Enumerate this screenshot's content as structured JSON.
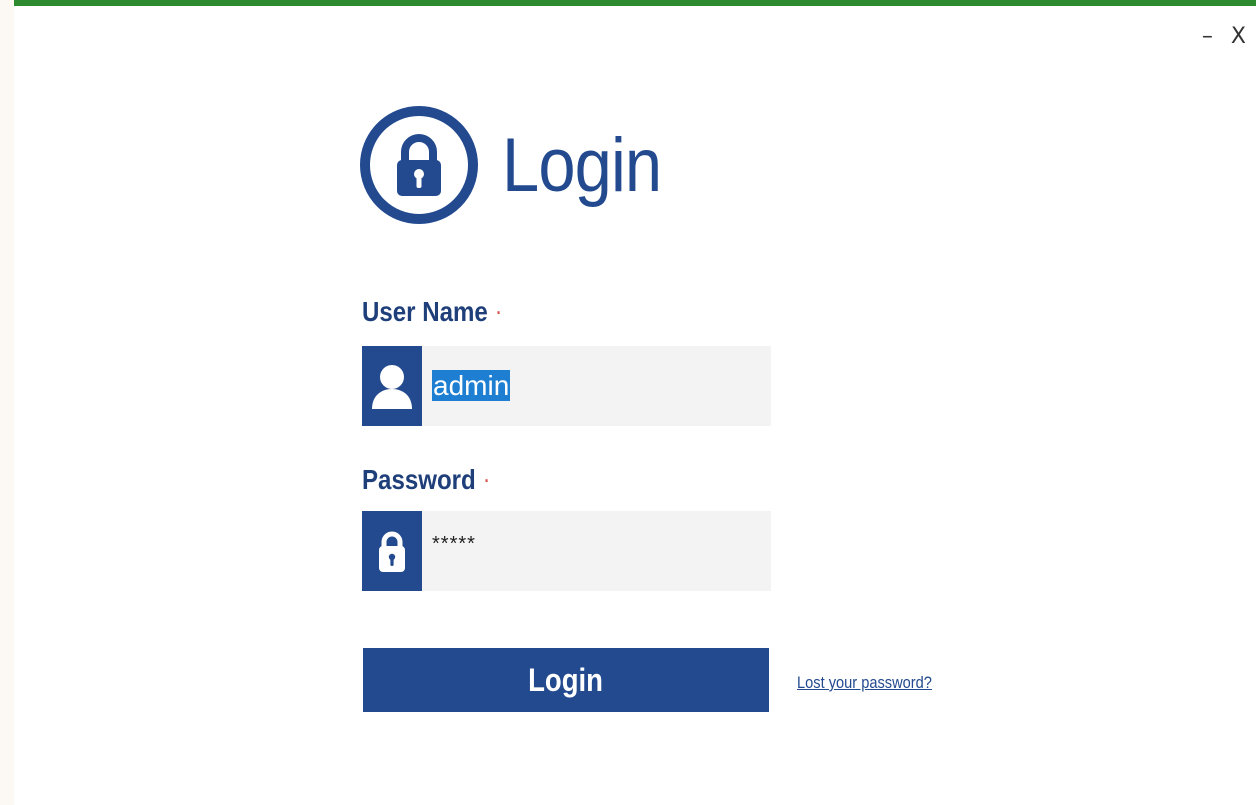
{
  "window": {
    "minimize_label": "–",
    "close_label": "X"
  },
  "header": {
    "title": "Login",
    "logo_icon": "padlock-icon"
  },
  "form": {
    "username": {
      "label": "User Name",
      "required_mark": "·",
      "value": "admin",
      "icon": "user-icon"
    },
    "password": {
      "label": "Password",
      "required_mark": "·",
      "value": "*****",
      "icon": "lock-icon"
    },
    "login_button": "Login",
    "lost_password_link": "Lost your password?"
  },
  "colors": {
    "brand_blue": "#234a8f",
    "window_top_border": "#2e8a2e",
    "selection": "#1e7fd2",
    "required": "#d9534f"
  }
}
